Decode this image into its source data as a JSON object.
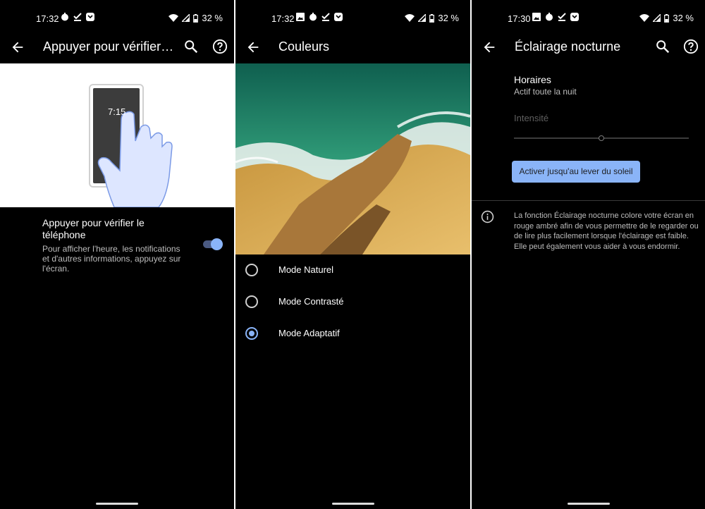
{
  "screens": [
    {
      "status": {
        "time": "17:32",
        "battery": "32 %"
      },
      "appbar": {
        "title": "Appuyer pour vérifier…"
      },
      "illustration": {
        "clock": "7:15"
      },
      "setting": {
        "title": "Appuyer pour vérifier le téléphone",
        "description": "Pour afficher l'heure, les notifications et d'autres informations, appuyez sur l'écran.",
        "toggle_on": true
      }
    },
    {
      "status": {
        "time": "17:32",
        "battery": "32 %"
      },
      "appbar": {
        "title": "Couleurs"
      },
      "options": [
        {
          "label": "Mode Naturel",
          "checked": false
        },
        {
          "label": "Mode Contrasté",
          "checked": false
        },
        {
          "label": "Mode Adaptatif",
          "checked": true
        }
      ]
    },
    {
      "status": {
        "time": "17:30",
        "battery": "32 %"
      },
      "appbar": {
        "title": "Éclairage nocturne"
      },
      "schedule": {
        "title": "Horaires",
        "value": "Actif toute la nuit"
      },
      "intensity": {
        "label": "Intensité",
        "level": 0.5
      },
      "button": {
        "label": "Activer jusqu'au lever du soleil"
      },
      "info": {
        "text": "La fonction Éclairage nocturne colore votre écran en rouge ambré afin de vous permettre de le regarder ou de lire plus facilement lorsque l'éclairage est faible. Elle peut également vous aider à vous endormir."
      }
    }
  ],
  "colors": {
    "accent": "#8ab4f8",
    "background": "#000000"
  }
}
